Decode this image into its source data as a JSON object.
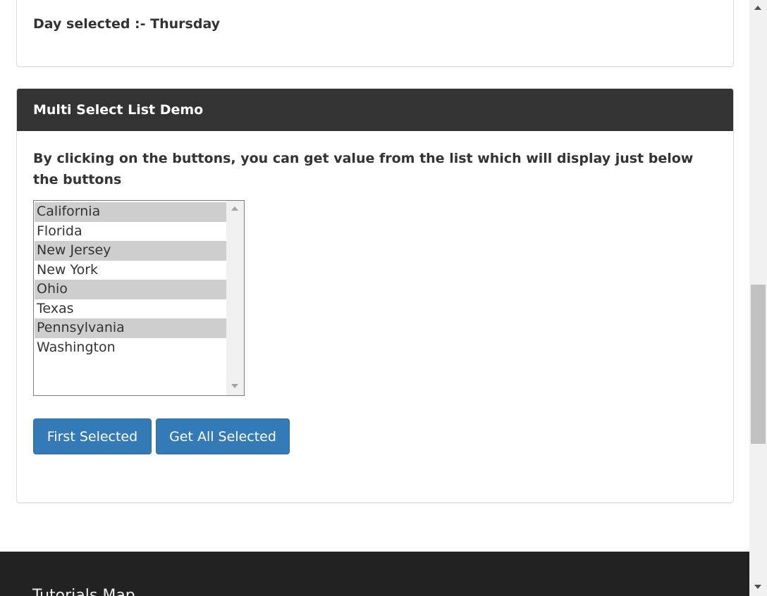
{
  "day_section": {
    "result_text": "Day selected :- Thursday"
  },
  "multi_select": {
    "heading": "Multi Select List Demo",
    "description": "By clicking on the buttons, you can get value from the list which will display just below the buttons",
    "options": [
      {
        "label": "California",
        "selected": true
      },
      {
        "label": "Florida",
        "selected": false
      },
      {
        "label": "New Jersey",
        "selected": true
      },
      {
        "label": "New York",
        "selected": false
      },
      {
        "label": "Ohio",
        "selected": true
      },
      {
        "label": "Texas",
        "selected": false
      },
      {
        "label": "Pennsylvania",
        "selected": true
      },
      {
        "label": "Washington",
        "selected": false
      }
    ],
    "first_selected_label": "First Selected",
    "get_all_selected_label": "Get All Selected"
  },
  "footer": {
    "title": "Tutorials Map"
  },
  "colors": {
    "heading_bg": "#333333",
    "button_bg": "#337ab7",
    "selected_option_bg": "#cecece",
    "footer_bg": "#222222"
  },
  "icons": {
    "list_scroll_up": "triangle-up-icon",
    "list_scroll_down": "triangle-down-icon",
    "page_scroll_up": "triangle-up-icon",
    "page_scroll_down": "triangle-down-icon"
  }
}
